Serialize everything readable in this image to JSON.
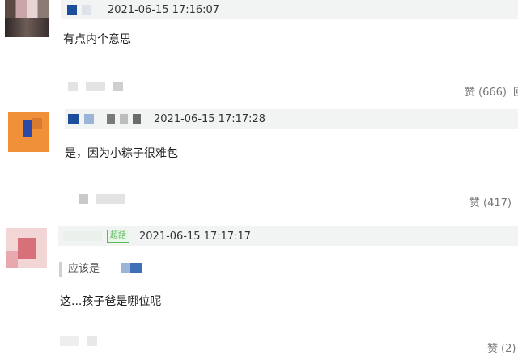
{
  "comments": [
    {
      "timestamp": "2021-06-15 17:16:07",
      "text": "有点内个意思",
      "like_icon": "赞",
      "like_count": "(666)",
      "extra": "回"
    },
    {
      "timestamp": "2021-06-15 17:17:28",
      "text": "是，因为小粽子很难包",
      "like_icon": "赞",
      "like_count": "(417)"
    },
    {
      "timestamp": "2021-06-15 17:17:17",
      "badge": "超話",
      "quote": "应该是",
      "text": "这...孩子爸是哪位呢",
      "like_icon": "赞",
      "like_count": "(2)"
    }
  ]
}
